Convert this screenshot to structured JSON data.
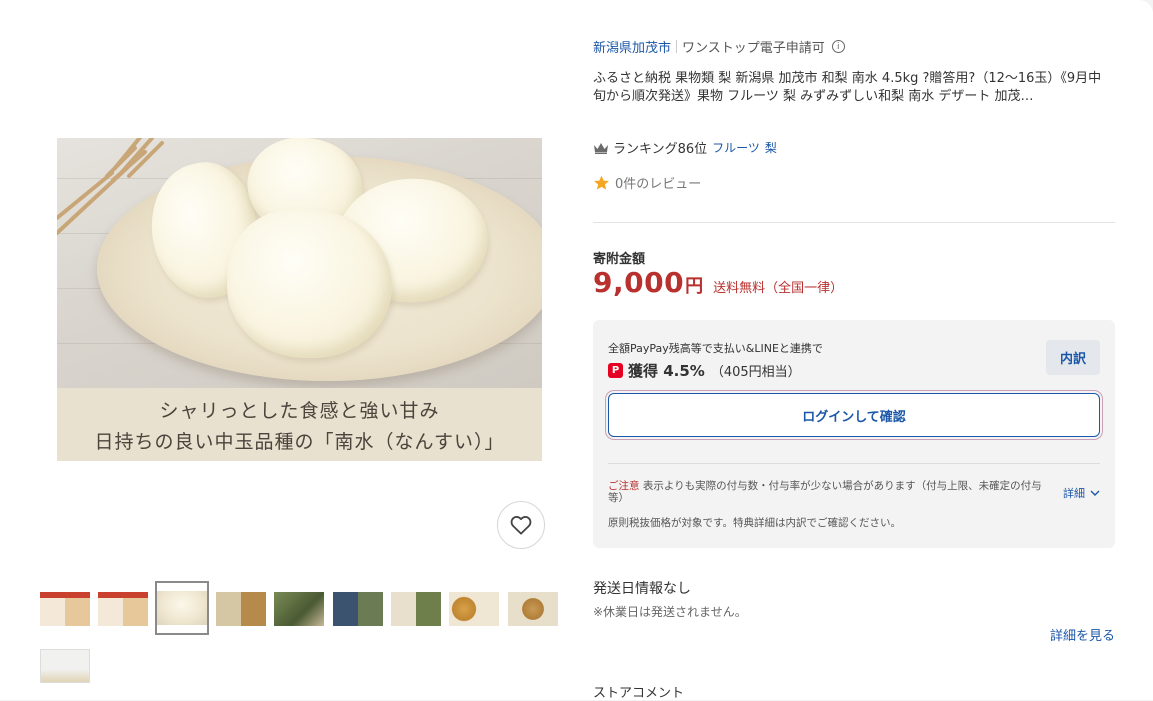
{
  "store": {
    "name": "新潟県加茂市",
    "badge": "ワンストップ電子申請可",
    "info_icon": "info-icon"
  },
  "product": {
    "title": "ふるさと納税 果物類 梨 新潟県 加茂市 和梨 南水 4.5kg ?贈答用?（12～16玉）《9月中旬から順次発送》果物 フルーツ 梨 みずみずしい和梨 南水 デザート 加茂…",
    "ranking_label": "ランキング86位",
    "ranking_category_1": "フルーツ",
    "ranking_category_2": "梨",
    "review_text": "0件のレビュー",
    "photo_caption_1": "シャリっとした食感と強い甘み",
    "photo_caption_2": "日持ちの良い中玉品種の「南水（なんすい）」"
  },
  "price": {
    "label": "寄附金額",
    "amount": "9,000",
    "currency": "円",
    "shipping": "送料無料（全国一律）"
  },
  "points": {
    "description": "全額PayPay残高等で支払い&LINEと連携で",
    "icon_letter": "P",
    "gain": "獲得 4.5%",
    "gain_detail": "（405円相当）",
    "breakdown_label": "内訳",
    "login_label": "ログインして確認",
    "notice_title": "ご注意",
    "notice_text": "表示よりも実際の付与数・付与率が少ない場合があります（付与上限、未確定の付与等）",
    "detail_label": "詳細",
    "notice_2": "原則税抜価格が対象です。特典詳細は内訳でご確認ください。"
  },
  "shipping_info": {
    "status": "発送日情報なし",
    "note": "※休業日は発送されません。",
    "more_label": "詳細を見る"
  },
  "store_comment_label": "ストアコメント",
  "thumbnails": {
    "count": 10,
    "selected_index": 2
  },
  "colors": {
    "link": "#1b57a8",
    "price": "#b8312f",
    "paypay": "#e60021",
    "star": "#f5a623"
  }
}
